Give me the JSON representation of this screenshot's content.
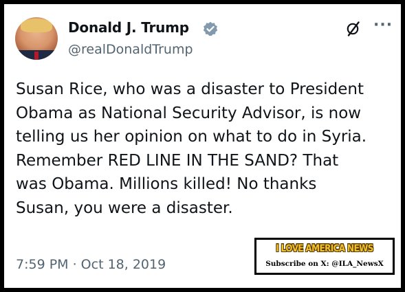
{
  "author": {
    "display_name": "Donald J. Trump",
    "handle": "@realDonaldTrump",
    "verified_color": "#829aab"
  },
  "icons": {
    "header_logo": "x-grok-icon",
    "more": "more-horizontal-icon",
    "more_glyph": "···"
  },
  "tweet": {
    "lines": [
      "Susan Rice, who was a disaster to President",
      "Obama as National Security Advisor, is now",
      "telling us her opinion on what to do in Syria.",
      "Remember RED LINE IN THE SAND? That",
      "was Obama. Millions killed! No thanks",
      "Susan, you were a disaster."
    ],
    "timestamp": "7:59 PM · Oct 18, 2019"
  },
  "watermark": {
    "title": "I LOVE AMERICA NEWS",
    "subscribe_label": "Subscribe on X: @ILA_NewsX"
  },
  "colors": {
    "text_primary": "#0f1419",
    "text_secondary": "#536471",
    "frame": "#000000",
    "watermark_gold": "#f2c230"
  }
}
